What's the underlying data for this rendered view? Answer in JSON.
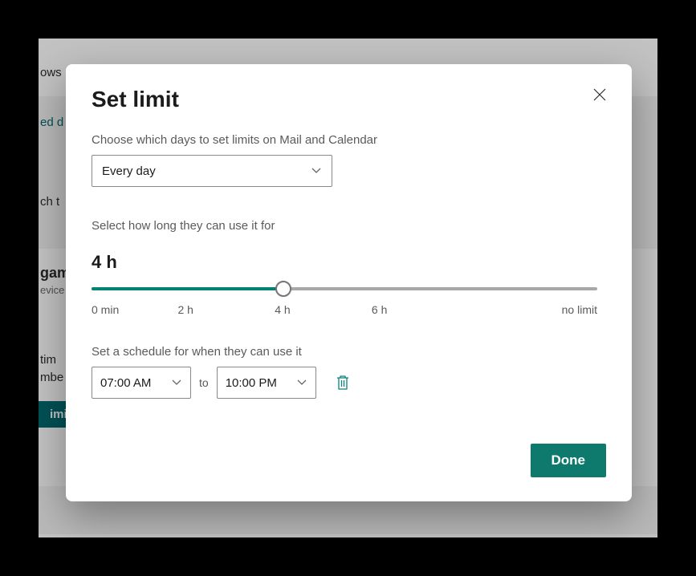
{
  "background": {
    "title_fragment_1": "ows",
    "link_fragment": "ed d",
    "row_fragment_1": "ch t",
    "app_title_fragment": "gam",
    "app_sub_fragment": "evice",
    "para_fragment_1": "tim",
    "para_fragment_2": "mbe",
    "button_fragment": "imit"
  },
  "modal": {
    "title": "Set limit",
    "days_label": "Choose which days to set limits on Mail and Calendar",
    "days_value": "Every day",
    "duration_label": "Select how long they can use it for",
    "duration_value": "4 h",
    "slider": {
      "percent": 38,
      "ticks": [
        "0 min",
        "2 h",
        "4 h",
        "6 h",
        "no limit"
      ]
    },
    "schedule_label": "Set a schedule for when they can use it",
    "schedule": {
      "from": "07:00 AM",
      "to_label": "to",
      "to": "10:00 PM"
    },
    "done": "Done"
  }
}
